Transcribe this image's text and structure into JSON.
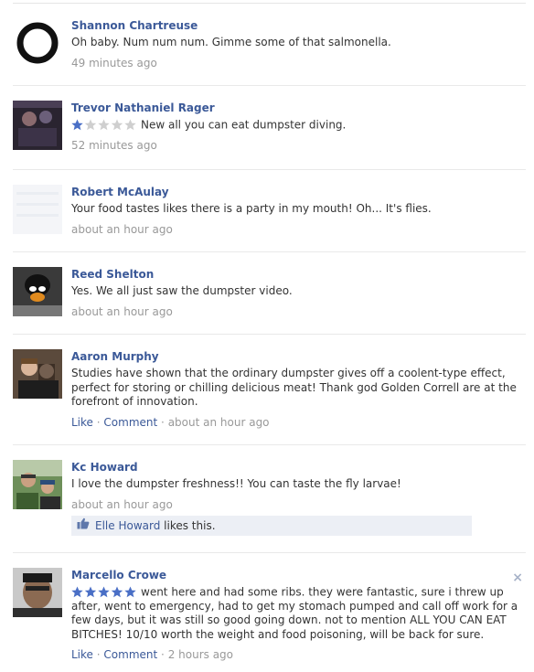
{
  "comments": [
    {
      "name": "Shannon Chartreuse",
      "text": "Oh baby. Num num num. Gimme some of that salmonella.",
      "time": "49 minutes ago",
      "avatar": "ring-avatar"
    },
    {
      "name": "Trevor Nathaniel Rager",
      "rating": 1,
      "text": "New all you can eat dumpster diving.",
      "time": "52 minutes ago",
      "avatar": "party-photo-avatar"
    },
    {
      "name": "Robert McAulay",
      "text": "Your food tastes likes there is a party in my mouth! Oh... It's flies.",
      "time": "about an hour ago",
      "avatar": "blank-avatar"
    },
    {
      "name": "Reed Shelton",
      "text": "Yes. We all just saw the dumpster video.",
      "time": "about an hour ago",
      "avatar": "puppet-avatar"
    },
    {
      "name": "Aaron Murphy",
      "text": "Studies have shown that the ordinary dumpster gives off a coolent-type effect, perfect for storing or chilling delicious meat! Thank god Golden Correll are at the forefront of innovation.",
      "like": "Like",
      "comment": "Comment",
      "time": "about an hour ago",
      "avatar": "couple-avatar"
    },
    {
      "name": "Kc Howard",
      "text": "I love the dumpster freshness!! You can taste the fly larvae!",
      "time": "about an hour ago",
      "liker": "Elle Howard",
      "likes_text": "likes this.",
      "avatar": "outdoor-couple-avatar"
    },
    {
      "name": "Marcello Crowe",
      "rating": 5,
      "text": "went here and had some ribs. they were fantastic, sure i threw up after, went to emergency, had to get my stomach pumped and call off work for a few days, but it was still so good going down. not to mention ALL YOU CAN EAT BITCHES! 10/10 worth the weight and food poisoning, will be back for sure.",
      "like": "Like",
      "comment": "Comment",
      "time": "2 hours ago",
      "avatar": "man-avatar"
    }
  ],
  "dot": "·",
  "close_symbol": "×",
  "colors": {
    "link": "#3b5998",
    "meta": "#999999",
    "star_on": "#4a6fc6",
    "star_off": "#cccccc"
  }
}
